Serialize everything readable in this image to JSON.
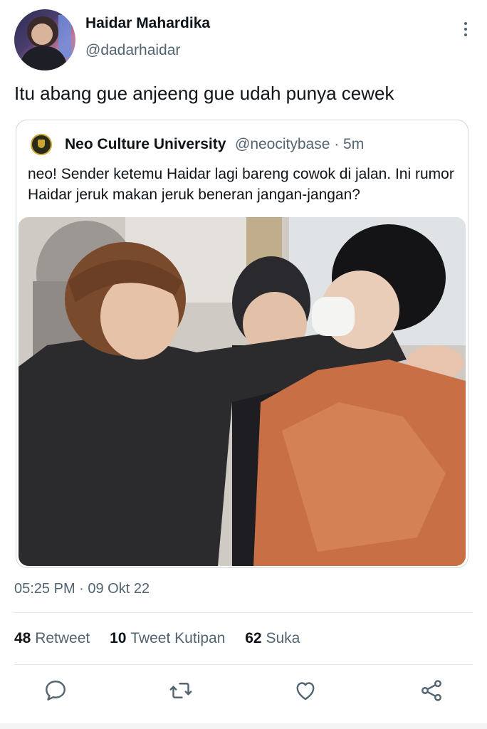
{
  "author": {
    "name": "Haidar Mahardika",
    "handle": "@dadarhaidar"
  },
  "tweet_text": "Itu abang gue anjeeng gue udah punya cewek",
  "quoted": {
    "name": "Neo Culture University",
    "handle_time": "@neocitybase · 5m",
    "text": "neo! Sender ketemu Haidar lagi bareng cowok di jalan. Ini rumor Haidar jeruk makan jeruk beneran jangan-jangan?"
  },
  "timestamp": "05:25 PM · 09 Okt 22",
  "stats": {
    "retweets_count": "48",
    "retweets_label": "Retweet",
    "quotes_count": "10",
    "quotes_label": "Tweet Kutipan",
    "likes_count": "62",
    "likes_label": "Suka"
  },
  "icons": {
    "reply": "reply-icon",
    "retweet": "retweet-icon",
    "like": "like-icon",
    "share": "share-icon",
    "more": "more-icon"
  },
  "colors": {
    "text": "#0f1419",
    "secondary": "#536471",
    "border": "#cfd9de"
  }
}
